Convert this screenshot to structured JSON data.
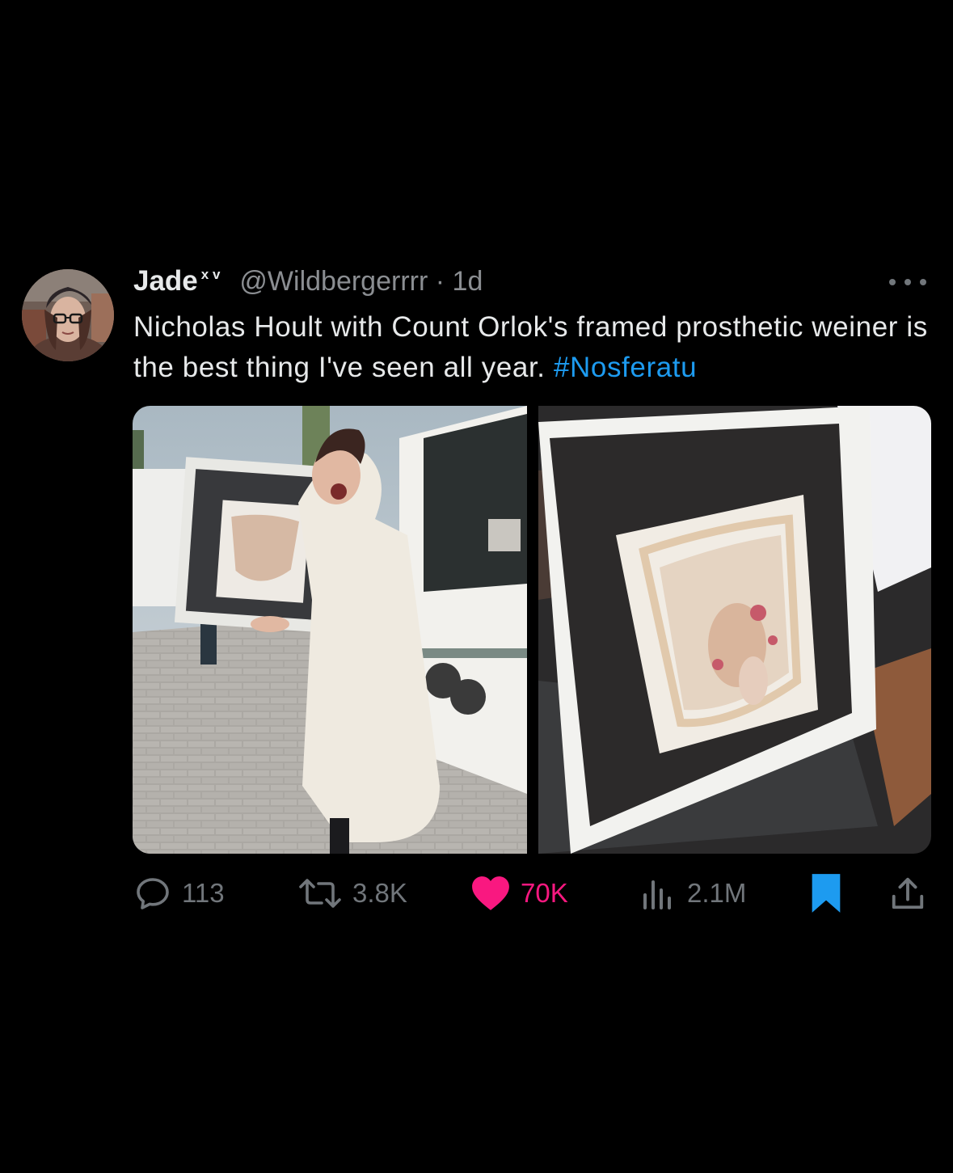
{
  "tweet": {
    "author": {
      "name": "Jade",
      "name_suffix": "x v",
      "handle": "@Wildbergerrrr",
      "separator": "·",
      "time": "1d"
    },
    "text": "Nicholas Hoult with Count Orlok's framed prosthetic weiner is the best thing I've seen all year.",
    "hashtag": "#Nosferatu",
    "media": [
      {
        "description": "man in white nightgown holding framed prosthetic outside trailer"
      },
      {
        "description": "close-up of framed prosthetic leaning on floor"
      }
    ],
    "actions": {
      "replies": "113",
      "reposts": "3.8K",
      "likes": "70K",
      "views": "2.1M"
    }
  },
  "colors": {
    "background": "#000000",
    "text": "#e7e9ea",
    "muted": "#71767b",
    "link": "#1d9bf0",
    "like": "#f91880"
  },
  "icons": [
    "more-icon",
    "reply-icon",
    "repost-icon",
    "like-icon",
    "views-icon",
    "bookmark-icon",
    "share-icon"
  ]
}
